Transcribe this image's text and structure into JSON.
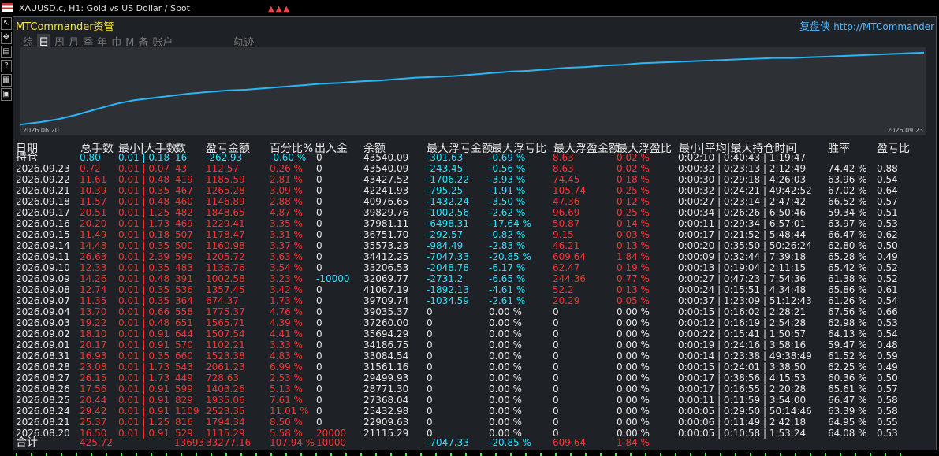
{
  "window": {
    "title": "XAUUSD.c, H1:  Gold vs US Dollar / Spot"
  },
  "app": {
    "title": "MTCommander资管",
    "brand_cn": "复盘侠",
    "brand_url": "http://MTCommander"
  },
  "tabs": [
    "综",
    "日",
    "周",
    "月",
    "季",
    "年",
    "巾",
    "M",
    "备",
    "账户",
    "轨迹"
  ],
  "active_tab": 1,
  "chart_data": {
    "type": "line",
    "x_start_label": "2026.06.20",
    "x_end_label": "2026.09.23",
    "ylim": [
      0,
      1
    ],
    "grid": false,
    "color": "#29b6f6",
    "values": [
      0.02,
      0.05,
      0.09,
      0.15,
      0.22,
      0.29,
      0.34,
      0.37,
      0.4,
      0.43,
      0.45,
      0.47,
      0.48,
      0.5,
      0.52,
      0.54,
      0.56,
      0.57,
      0.59,
      0.6,
      0.62,
      0.64,
      0.65,
      0.66,
      0.68,
      0.7,
      0.72,
      0.73,
      0.75,
      0.77,
      0.78,
      0.8,
      0.81,
      0.83,
      0.84,
      0.85,
      0.86,
      0.87,
      0.88,
      0.89,
      0.9,
      0.9,
      0.91,
      0.92,
      0.93,
      0.94,
      0.95,
      0.96,
      0.97
    ]
  },
  "table": {
    "headers": [
      "日期",
      "总手数",
      "最小|大手数",
      "数",
      "盈亏金额",
      "百分比%",
      "出入金",
      "余额",
      "最大浮亏金额",
      "最大浮亏比",
      "最大浮盈金额",
      "最大浮盈比",
      "最小|平均|最大持仓时间",
      "胜率",
      "盈亏比"
    ],
    "holding": {
      "label": "持仓",
      "lots": "0.80",
      "minmax": "0.01 | 0.18",
      "count": "16",
      "pl": "-262.93",
      "pct": "-0.60 %",
      "io": "0",
      "bal": "43540.09",
      "mfl": "-301.63",
      "mflp": "-0.69 %",
      "mfg": "8.63",
      "mfgp": "0.02 %",
      "time": "0:02:10 | 0:40:43 | 1:19:47"
    },
    "rows": [
      {
        "date": "2026.09.23",
        "lots": "0.72",
        "minmax": "0.01 | 0.07",
        "count": "43",
        "pl": "112.57",
        "pct": "0.26 %",
        "io": "0",
        "bal": "43540.09",
        "mfl": "-243.45",
        "mflp": "-0.56 %",
        "mfg": "8.63",
        "mfgp": "0.02 %",
        "time": "0:00:32 | 0:23:13 | 2:12:49",
        "win": "74.42 %",
        "pf": "0.88"
      },
      {
        "date": "2026.09.22",
        "lots": "11.61",
        "minmax": "0.01 | 0.48",
        "count": "419",
        "pl": "1185.59",
        "pct": "2.81 %",
        "io": "0",
        "bal": "43427.52",
        "mfl": "-1706.22",
        "mflp": "-3.93 %",
        "mfg": "74.45",
        "mfgp": "0.18 %",
        "time": "0:00:30 | 0:29:18 | 4:26:03",
        "win": "63.96 %",
        "pf": "0.54"
      },
      {
        "date": "2026.09.21",
        "lots": "10.39",
        "minmax": "0.01 | 0.35",
        "count": "467",
        "pl": "1265.28",
        "pct": "3.09 %",
        "io": "0",
        "bal": "42241.93",
        "mfl": "-795.25",
        "mflp": "-1.91 %",
        "mfg": "105.74",
        "mfgp": "0.25 %",
        "time": "0:00:32 | 0:24:21 | 49:42:52",
        "win": "67.02 %",
        "pf": "0.64"
      },
      {
        "date": "2026.09.18",
        "lots": "11.57",
        "minmax": "0.01 | 0.48",
        "count": "460",
        "pl": "1146.89",
        "pct": "2.88 %",
        "io": "0",
        "bal": "40976.65",
        "mfl": "-1432.24",
        "mflp": "-3.50 %",
        "mfg": "47.36",
        "mfgp": "0.12 %",
        "time": "0:00:27 | 0:23:14 | 2:47:42",
        "win": "66.52 %",
        "pf": "0.57"
      },
      {
        "date": "2026.09.17",
        "lots": "20.51",
        "minmax": "0.01 | 1.25",
        "count": "482",
        "pl": "1848.65",
        "pct": "4.87 %",
        "io": "0",
        "bal": "39829.76",
        "mfl": "-1002.56",
        "mflp": "-2.62 %",
        "mfg": "96.69",
        "mfgp": "0.25 %",
        "time": "0:00:34 | 0:26:26 | 6:50:46",
        "win": "59.34 %",
        "pf": "0.51"
      },
      {
        "date": "2026.09.16",
        "lots": "20.20",
        "minmax": "0.01 | 1.73",
        "count": "469",
        "pl": "1229.41",
        "pct": "3.35 %",
        "io": "0",
        "bal": "37981.11",
        "mfl": "-6498.31",
        "mflp": "-17.64 %",
        "mfg": "50.87",
        "mfgp": "0.14 %",
        "time": "0:00:11 | 0:29:34 | 6:57:01",
        "win": "63.97 %",
        "pf": "0.53"
      },
      {
        "date": "2026.09.15",
        "lots": "11.49",
        "minmax": "0.01 | 0.18",
        "count": "507",
        "pl": "1178.47",
        "pct": "3.31 %",
        "io": "0",
        "bal": "36751.70",
        "mfl": "-292.57",
        "mflp": "-0.82 %",
        "mfg": "9.15",
        "mfgp": "0.03 %",
        "time": "0:00:17 | 0:21:52 | 5:48:44",
        "win": "66.47 %",
        "pf": "0.62"
      },
      {
        "date": "2026.09.14",
        "lots": "14.48",
        "minmax": "0.01 | 0.35",
        "count": "500",
        "pl": "1160.98",
        "pct": "3.37 %",
        "io": "0",
        "bal": "35573.23",
        "mfl": "-984.49",
        "mflp": "-2.83 %",
        "mfg": "46.21",
        "mfgp": "0.13 %",
        "time": "0:00:20 | 0:35:50 | 50:26:24",
        "win": "62.80 %",
        "pf": "0.50"
      },
      {
        "date": "2026.09.11",
        "lots": "26.63",
        "minmax": "0.01 | 2.39",
        "count": "599",
        "pl": "1205.72",
        "pct": "3.63 %",
        "io": "0",
        "bal": "34412.25",
        "mfl": "-7047.33",
        "mflp": "-20.85 %",
        "mfg": "609.64",
        "mfgp": "1.84 %",
        "time": "0:00:09 | 0:32:44 | 7:39:18",
        "win": "65.28 %",
        "pf": "0.49"
      },
      {
        "date": "2026.09.10",
        "lots": "12.33",
        "minmax": "0.01 | 0.35",
        "count": "483",
        "pl": "1136.76",
        "pct": "3.54 %",
        "io": "0",
        "bal": "33206.53",
        "mfl": "-2048.78",
        "mflp": "-6.17 %",
        "mfg": "62.47",
        "mfgp": "0.19 %",
        "time": "0:00:13 | 0:19:04 | 2:11:15",
        "win": "65.42 %",
        "pf": "0.52"
      },
      {
        "date": "2026.09.09",
        "lots": "14.26",
        "minmax": "0.01 | 0.48",
        "count": "391",
        "pl": "1002.58",
        "pct": "3.23 %",
        "io": "-10000",
        "bal": "32069.77",
        "mfl": "-2731.2",
        "mflp": "-6.65 %",
        "mfg": "244.36",
        "mfgp": "0.77 %",
        "time": "0:00:27 | 0:47:23 | 7:54:36",
        "win": "61.38 %",
        "pf": "0.52"
      },
      {
        "date": "2026.09.08",
        "lots": "12.74",
        "minmax": "0.01 | 0.35",
        "count": "536",
        "pl": "1357.45",
        "pct": "3.42 %",
        "io": "0",
        "bal": "41067.19",
        "mfl": "-1892.13",
        "mflp": "-4.61 %",
        "mfg": "52.2",
        "mfgp": "0.13 %",
        "time": "0:00:24 | 0:15:51 | 4:34:48",
        "win": "65.86 %",
        "pf": "0.61"
      },
      {
        "date": "2026.09.07",
        "lots": "11.35",
        "minmax": "0.01 | 0.35",
        "count": "364",
        "pl": "674.37",
        "pct": "1.73 %",
        "io": "0",
        "bal": "39709.74",
        "mfl": "-1034.59",
        "mflp": "-2.61 %",
        "mfg": "20.29",
        "mfgp": "0.05 %",
        "time": "0:00:37 | 1:23:09 | 51:12:43",
        "win": "61.26 %",
        "pf": "0.54"
      },
      {
        "date": "2026.09.04",
        "lots": "13.70",
        "minmax": "0.01 | 0.66",
        "count": "558",
        "pl": "1775.37",
        "pct": "4.76 %",
        "io": "0",
        "bal": "39035.37",
        "mfl": "0",
        "mflp": "0.00 %",
        "mfg": "0",
        "mfgp": "0.00 %",
        "time": "0:00:15 | 0:16:02 | 2:28:21",
        "win": "67.56 %",
        "pf": "0.66"
      },
      {
        "date": "2026.09.03",
        "lots": "19.22",
        "minmax": "0.01 | 0.48",
        "count": "651",
        "pl": "1565.71",
        "pct": "4.39 %",
        "io": "0",
        "bal": "37260.00",
        "mfl": "0",
        "mflp": "0.00 %",
        "mfg": "0",
        "mfgp": "0.00 %",
        "time": "0:00:12 | 0:16:19 | 2:54:28",
        "win": "62.98 %",
        "pf": "0.53"
      },
      {
        "date": "2026.09.02",
        "lots": "18.10",
        "minmax": "0.01 | 0.91",
        "count": "644",
        "pl": "1507.54",
        "pct": "4.41 %",
        "io": "0",
        "bal": "35694.29",
        "mfl": "0",
        "mflp": "0.00 %",
        "mfg": "0",
        "mfgp": "0.00 %",
        "time": "0:00:22 | 0:15:41 | 1:50:57",
        "win": "64.13 %",
        "pf": "0.54"
      },
      {
        "date": "2026.09.01",
        "lots": "20.17",
        "minmax": "0.01 | 0.91",
        "count": "570",
        "pl": "1102.21",
        "pct": "3.33 %",
        "io": "0",
        "bal": "34186.75",
        "mfl": "0",
        "mflp": "0.00 %",
        "mfg": "0",
        "mfgp": "0.00 %",
        "time": "0:00:19 | 0:24:16 | 3:58:16",
        "win": "59.47 %",
        "pf": "0.48"
      },
      {
        "date": "2026.08.31",
        "lots": "16.93",
        "minmax": "0.01 | 0.35",
        "count": "660",
        "pl": "1523.38",
        "pct": "4.83 %",
        "io": "0",
        "bal": "33084.54",
        "mfl": "0",
        "mflp": "0.00 %",
        "mfg": "0",
        "mfgp": "0.00 %",
        "time": "0:00:14 | 0:23:38 | 49:38:49",
        "win": "61.52 %",
        "pf": "0.59"
      },
      {
        "date": "2026.08.28",
        "lots": "23.08",
        "minmax": "0.01 | 1.73",
        "count": "543",
        "pl": "2061.23",
        "pct": "6.99 %",
        "io": "0",
        "bal": "31561.16",
        "mfl": "0",
        "mflp": "0.00 %",
        "mfg": "0",
        "mfgp": "0.00 %",
        "time": "0:00:15 | 0:24:01 | 3:38:50",
        "win": "62.25 %",
        "pf": "0.49"
      },
      {
        "date": "2026.08.27",
        "lots": "26.15",
        "minmax": "0.01 | 1.73",
        "count": "449",
        "pl": "728.63",
        "pct": "2.53 %",
        "io": "0",
        "bal": "29499.93",
        "mfl": "0",
        "mflp": "0.00 %",
        "mfg": "0",
        "mfgp": "0.00 %",
        "time": "0:00:17 | 0:38:56 | 4:15:53",
        "win": "60.36 %",
        "pf": "0.50"
      },
      {
        "date": "2026.08.26",
        "lots": "17.56",
        "minmax": "0.01 | 0.91",
        "count": "599",
        "pl": "1403.26",
        "pct": "5.13 %",
        "io": "0",
        "bal": "28771.30",
        "mfl": "0",
        "mflp": "0.00 %",
        "mfg": "0",
        "mfgp": "0.00 %",
        "time": "0:00:17 | 0:16:55 | 2:20:28",
        "win": "65.61 %",
        "pf": "0.57"
      },
      {
        "date": "2026.08.25",
        "lots": "20.44",
        "minmax": "0.01 | 0.91",
        "count": "829",
        "pl": "1935.06",
        "pct": "7.61 %",
        "io": "0",
        "bal": "27368.04",
        "mfl": "0",
        "mflp": "0.00 %",
        "mfg": "0",
        "mfgp": "0.00 %",
        "time": "0:00:11 | 0:11:59 | 3:54:00",
        "win": "66.47 %",
        "pf": "0.58"
      },
      {
        "date": "2026.08.24",
        "lots": "29.42",
        "minmax": "0.01 | 0.91",
        "count": "1109",
        "pl": "2523.35",
        "pct": "11.01 %",
        "io": "0",
        "bal": "25432.98",
        "mfl": "0",
        "mflp": "0.00 %",
        "mfg": "0",
        "mfgp": "0.00 %",
        "time": "0:00:05 | 0:29:50 | 50:14:46",
        "win": "63.39 %",
        "pf": "0.58"
      },
      {
        "date": "2026.08.21",
        "lots": "25.37",
        "minmax": "0.01 | 1.25",
        "count": "816",
        "pl": "1794.34",
        "pct": "8.50 %",
        "io": "0",
        "bal": "22909.63",
        "mfl": "0",
        "mflp": "0.00 %",
        "mfg": "0",
        "mfgp": "0.00 %",
        "time": "0:00:06 | 0:11:49 | 2:42:18",
        "win": "64.95 %",
        "pf": "0.55"
      },
      {
        "date": "2026.08.20",
        "lots": "16.50",
        "minmax": "0.01 | 0.91",
        "count": "529",
        "pl": "1115.29",
        "pct": "5.58 %",
        "io": "20000",
        "bal": "21115.29",
        "mfl": "0",
        "mflp": "0.00 %",
        "mfg": "0",
        "mfgp": "0.00 %",
        "time": "0:00:05 | 0:10:58 | 1:53:24",
        "win": "64.08 %",
        "pf": "0.53"
      }
    ],
    "totals": {
      "label": "合计",
      "lots": "425.72",
      "count": "13693",
      "pl": "33277.16",
      "pct": "107.94 %",
      "io": "10000",
      "mfl": "-7047.33",
      "mflp": "-20.85 %",
      "mfg": "609.64",
      "mfgp": "1.84 %"
    }
  }
}
